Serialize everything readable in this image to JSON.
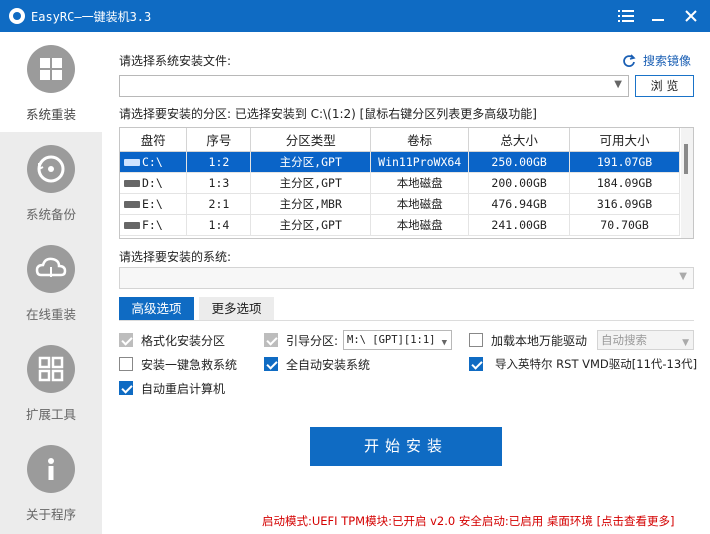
{
  "window": {
    "title": "EasyRC—一键装机3.3"
  },
  "sidebar": {
    "items": [
      {
        "label": "系统重装",
        "icon": "windows-icon"
      },
      {
        "label": "系统备份",
        "icon": "backup-icon"
      },
      {
        "label": "在线重装",
        "icon": "cloud-icon"
      },
      {
        "label": "扩展工具",
        "icon": "grid-icon"
      },
      {
        "label": "关于程序",
        "icon": "info-icon"
      }
    ]
  },
  "main": {
    "install_file_label": "请选择系统安装文件:",
    "search_mirror": "搜索镜像",
    "install_file_value": "",
    "browse": "浏 览",
    "partition_label": "请选择要安装的分区: 已选择安装到 C:\\(1:2) [鼠标右键分区列表更多高级功能]",
    "table": {
      "headers": [
        "盘符",
        "序号",
        "分区类型",
        "卷标",
        "总大小",
        "可用大小"
      ],
      "rows": [
        {
          "drive": "C:\\",
          "index": "1:2",
          "type": "主分区,GPT",
          "label": "Win11ProWX64",
          "total": "250.00GB",
          "free": "191.07GB",
          "selected": true
        },
        {
          "drive": "D:\\",
          "index": "1:3",
          "type": "主分区,GPT",
          "label": "本地磁盘",
          "total": "200.00GB",
          "free": "184.09GB"
        },
        {
          "drive": "E:\\",
          "index": "2:1",
          "type": "主分区,MBR",
          "label": "本地磁盘",
          "total": "476.94GB",
          "free": "316.09GB"
        },
        {
          "drive": "F:\\",
          "index": "1:4",
          "type": "主分区,GPT",
          "label": "本地磁盘",
          "total": "241.00GB",
          "free": "70.70GB"
        }
      ]
    },
    "system_label": "请选择要安装的系统:",
    "system_value": "",
    "tabs": [
      "高级选项",
      "更多选项"
    ],
    "options": {
      "format": "格式化安装分区",
      "boot_partition": "引导分区:",
      "boot_value": "M:\\ [GPT][1:1]",
      "load_driver": "加载本地万能驱动",
      "auto_search": "自动搜索",
      "rescue": "安装一键急救系统",
      "auto_install": "全自动安装系统",
      "import_intel": "导入英特尔 RST VMD驱动[11代-13代]",
      "auto_restart": "自动重启计算机"
    },
    "start_install": "开始安装"
  },
  "status": "启动模式:UEFI TPM模块:已开启 v2.0 安全启动:已启用 桌面环境 [点击查看更多]",
  "colors": {
    "accent": "#0f6bc3",
    "status_red": "#d40000"
  }
}
